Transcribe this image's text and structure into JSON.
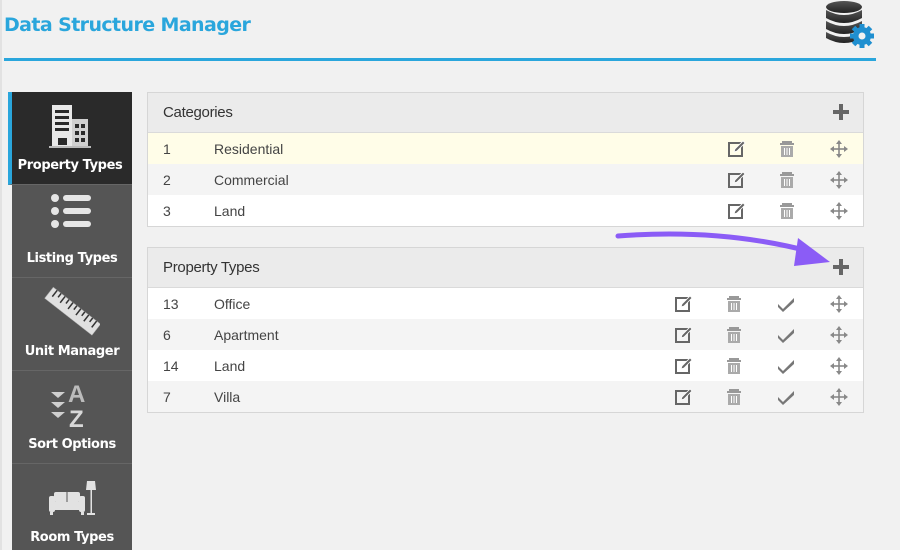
{
  "header": {
    "title": "Data Structure Manager",
    "icon": "database-gear-icon",
    "accent_color": "#2aa6dc"
  },
  "sidebar": {
    "items": [
      {
        "label": "Property Types",
        "icon": "building-icon",
        "active": true
      },
      {
        "label": "Listing Types",
        "icon": "list-icon",
        "active": false
      },
      {
        "label": "Unit Manager",
        "icon": "ruler-icon",
        "active": false
      },
      {
        "label": "Sort Options",
        "icon": "sort-az-icon",
        "active": false
      },
      {
        "label": "Room Types",
        "icon": "sofa-lamp-icon",
        "active": false
      }
    ]
  },
  "categories": {
    "title": "Categories",
    "add_icon": "plus-icon",
    "rows": [
      {
        "id": "1",
        "name": "Residential",
        "highlighted": true
      },
      {
        "id": "2",
        "name": "Commercial",
        "highlighted": false
      },
      {
        "id": "3",
        "name": "Land",
        "highlighted": false
      }
    ]
  },
  "property_types": {
    "title": "Property Types",
    "add_icon": "plus-icon",
    "rows": [
      {
        "id": "13",
        "name": "Office"
      },
      {
        "id": "6",
        "name": "Apartment"
      },
      {
        "id": "14",
        "name": "Land"
      },
      {
        "id": "7",
        "name": "Villa"
      }
    ]
  },
  "annotation": {
    "arrow_color": "#8b5cf6",
    "points_to": "property-types-add-button"
  }
}
